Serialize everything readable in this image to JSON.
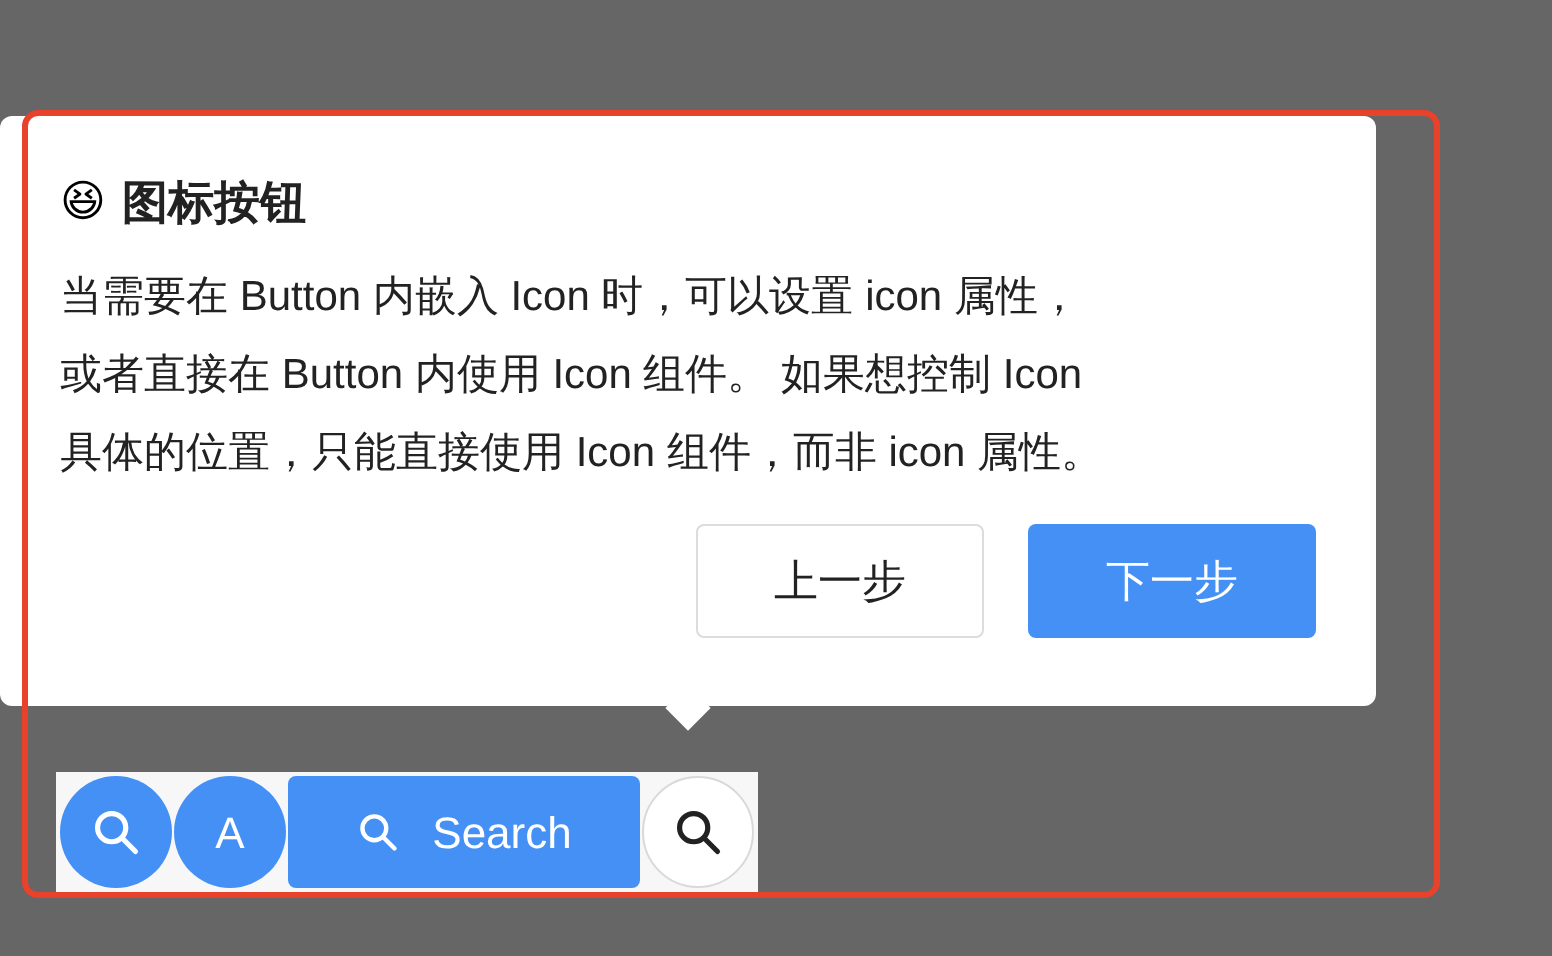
{
  "popover": {
    "emoji": "😆",
    "title": "图标按钮",
    "body_lines": [
      "当需要在 Button 内嵌入 Icon 时，可以设置 icon 属性，",
      "或者直接在 Button 内使用 Icon 组件。 如果想控制 Icon",
      "具体的位置，只能直接使用 Icon 组件，而非 icon 属性。"
    ],
    "buttons": [
      {
        "label": "上一步",
        "kind": "default"
      },
      {
        "label": "下一步",
        "kind": "primary"
      }
    ]
  },
  "demo_buttons": [
    {
      "kind": "icon-primary-circle"
    },
    {
      "kind": "text-primary-circle",
      "label": "A"
    },
    {
      "kind": "icon-text-primary",
      "label": "Search"
    },
    {
      "kind": "icon-default-circle"
    }
  ]
}
